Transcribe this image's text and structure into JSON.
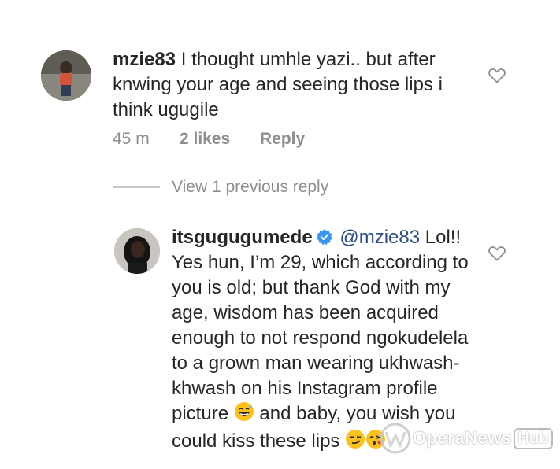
{
  "comment": {
    "username": "mzie83",
    "text": "I thought umhle yazi.. but after knwing your age  and seeing those lips i think ugugile",
    "time": "45 m",
    "likes": "2 likes",
    "reply_label": "Reply",
    "avatar_icon": "profile-photo"
  },
  "view_replies": {
    "label": "View 1 previous reply"
  },
  "reply": {
    "username": "itsgugugumede",
    "verified_icon": "verified-badge-icon",
    "mention": "@mzie83",
    "text_part1": "Lol!! Yes hun, I’m 29, which according to you is old; but thank God with my age, wisdom has been acquired enough to not respond ngokudelela to a grown man wearing ukhwash-khwash on his Instagram profile picture",
    "text_part2": "and baby, you wish you could kiss these lips",
    "emojis": [
      "grinning-sweat-emoji",
      "smirk-emoji",
      "kissing-heart-emoji"
    ]
  },
  "watermark": {
    "text": "OperaNews",
    "badge": "Hub"
  },
  "colors": {
    "text": "#262626",
    "meta": "#8e8e8e",
    "mention": "#2b4f82",
    "verified": "#3897f0"
  }
}
